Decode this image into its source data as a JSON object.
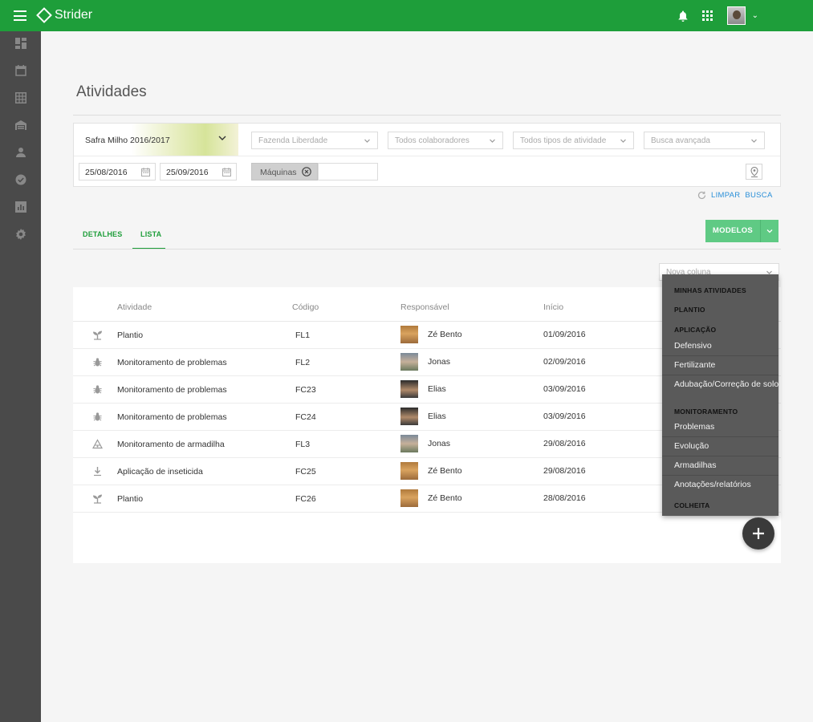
{
  "app": {
    "name": "Strider"
  },
  "page": {
    "title": "Atividades"
  },
  "filters": {
    "season": "Safra Milho 2016/2017",
    "farm_placeholder": "Fazenda Liberdade",
    "collaborators_placeholder": "Todos colaboradores",
    "activity_types_placeholder": "Todos tipos de atividade",
    "advanced_search_placeholder": "Busca avançada",
    "date_from": "25/08/2016",
    "date_to": "25/09/2016",
    "chip": "Máquinas",
    "clear_search": "LIMPAR  BUSCA"
  },
  "tabs": [
    {
      "label": "DETALHES"
    },
    {
      "label": "LISTA"
    }
  ],
  "models_button": "MODELOS",
  "new_column_placeholder": "Nova coluna",
  "table": {
    "headers": [
      "Atividade",
      "Código",
      "Responsável",
      "Início"
    ],
    "rows": [
      {
        "icon": "sprout-icon",
        "activity": "Plantio",
        "code": "FL1",
        "responsible": "Zé Bento",
        "start": "01/09/2016"
      },
      {
        "icon": "bug-icon",
        "activity": "Monitoramento de problemas",
        "code": "FL2",
        "responsible": "Jonas",
        "start": "02/09/2016"
      },
      {
        "icon": "bug-icon",
        "activity": "Monitoramento de problemas",
        "code": "FC23",
        "responsible": "Elias",
        "start": "03/09/2016"
      },
      {
        "icon": "bug-icon",
        "activity": "Monitoramento de problemas",
        "code": "FC24",
        "responsible": "Elias",
        "start": "03/09/2016"
      },
      {
        "icon": "trap-icon",
        "activity": "Monitoramento de armadilha",
        "code": "FL3",
        "responsible": "Jonas",
        "start": "29/08/2016"
      },
      {
        "icon": "spray-icon",
        "activity": "Aplicação de inseticida",
        "code": "FC25",
        "responsible": "Zé Bento",
        "start": "29/08/2016"
      },
      {
        "icon": "sprout-icon",
        "activity": "Plantio",
        "code": "FC26",
        "responsible": "Zé Bento",
        "start": "28/08/2016"
      }
    ]
  },
  "dropdown": {
    "minhas_atividades": "MINHAS ATIVIDADES",
    "plantio": "PLANTIO",
    "aplicacao": "APLICAÇÃO",
    "aplicacao_items": [
      "Defensivo",
      "Fertilizante",
      "Adubação/Correção de solo"
    ],
    "monitoramento": "MONITORAMENTO",
    "monitoramento_items": [
      "Problemas",
      "Evolução",
      "Armadilhas",
      "Anotações/relatórios"
    ],
    "colheita": "COLHEITA"
  },
  "colors": {
    "brand": "#1e9e3a",
    "sidebar": "#4a4a4a",
    "models_button": "#5fca84",
    "link": "#2a8fd8"
  }
}
